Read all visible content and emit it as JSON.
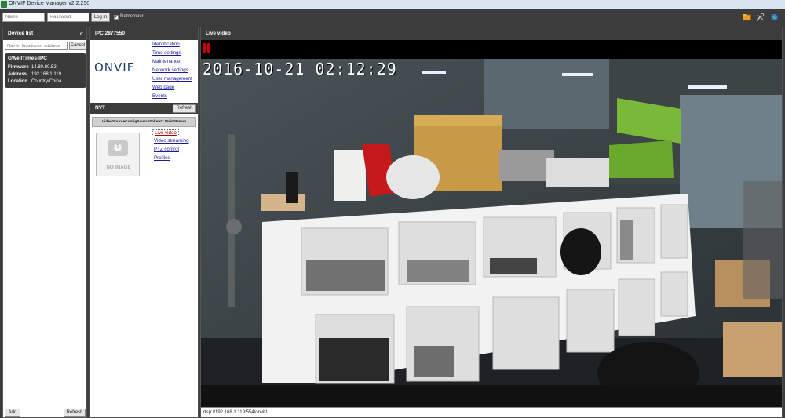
{
  "window": {
    "title": "ONVIF Device Manager v2.2.250"
  },
  "toolbar": {
    "name_placeholder": "Name",
    "password_placeholder": "Password",
    "login_label": "Log in",
    "remember_label": "Remember",
    "remember_checked": "✔"
  },
  "device_list": {
    "header": "Device list",
    "collapse_glyph": "«",
    "search_placeholder": "Name, location or address",
    "cancel_label": "Cancel",
    "devices": [
      {
        "name": "GWellTimes-IPC",
        "firmware_label": "Firmware",
        "firmware": "14.80.80.52",
        "address_label": "Address",
        "address": "192.168.1.119",
        "location_label": "Location",
        "location": "Country/China"
      }
    ],
    "add_label": "Add",
    "refresh_label": "Refresh"
  },
  "device_panel": {
    "header": "IPC 2877550",
    "logo_text": "ONVIF",
    "menu": [
      "Identification",
      "Time settings",
      "Maintenance",
      "Network settings",
      "User management",
      "Web page",
      "Events"
    ],
    "nvt_header": "NVT",
    "nvt_refresh_label": "Refresh",
    "profile_token": "VideoSourceConfigSourceToken0: MainStream",
    "no_image_label": "NO IMAGE",
    "profile_links": [
      "Live video",
      "Video streaming",
      "PTZ control",
      "Profiles"
    ]
  },
  "video_panel": {
    "header": "Live video",
    "timestamp": "2016-10-21  02:12:29",
    "stream_url": "rtsp://192.168.1.119:554/onvif1"
  },
  "colors": {
    "chrome_dark": "#3c3c3c",
    "link": "#1a1a99",
    "active_link": "#b00000",
    "rec": "#cc0000"
  }
}
